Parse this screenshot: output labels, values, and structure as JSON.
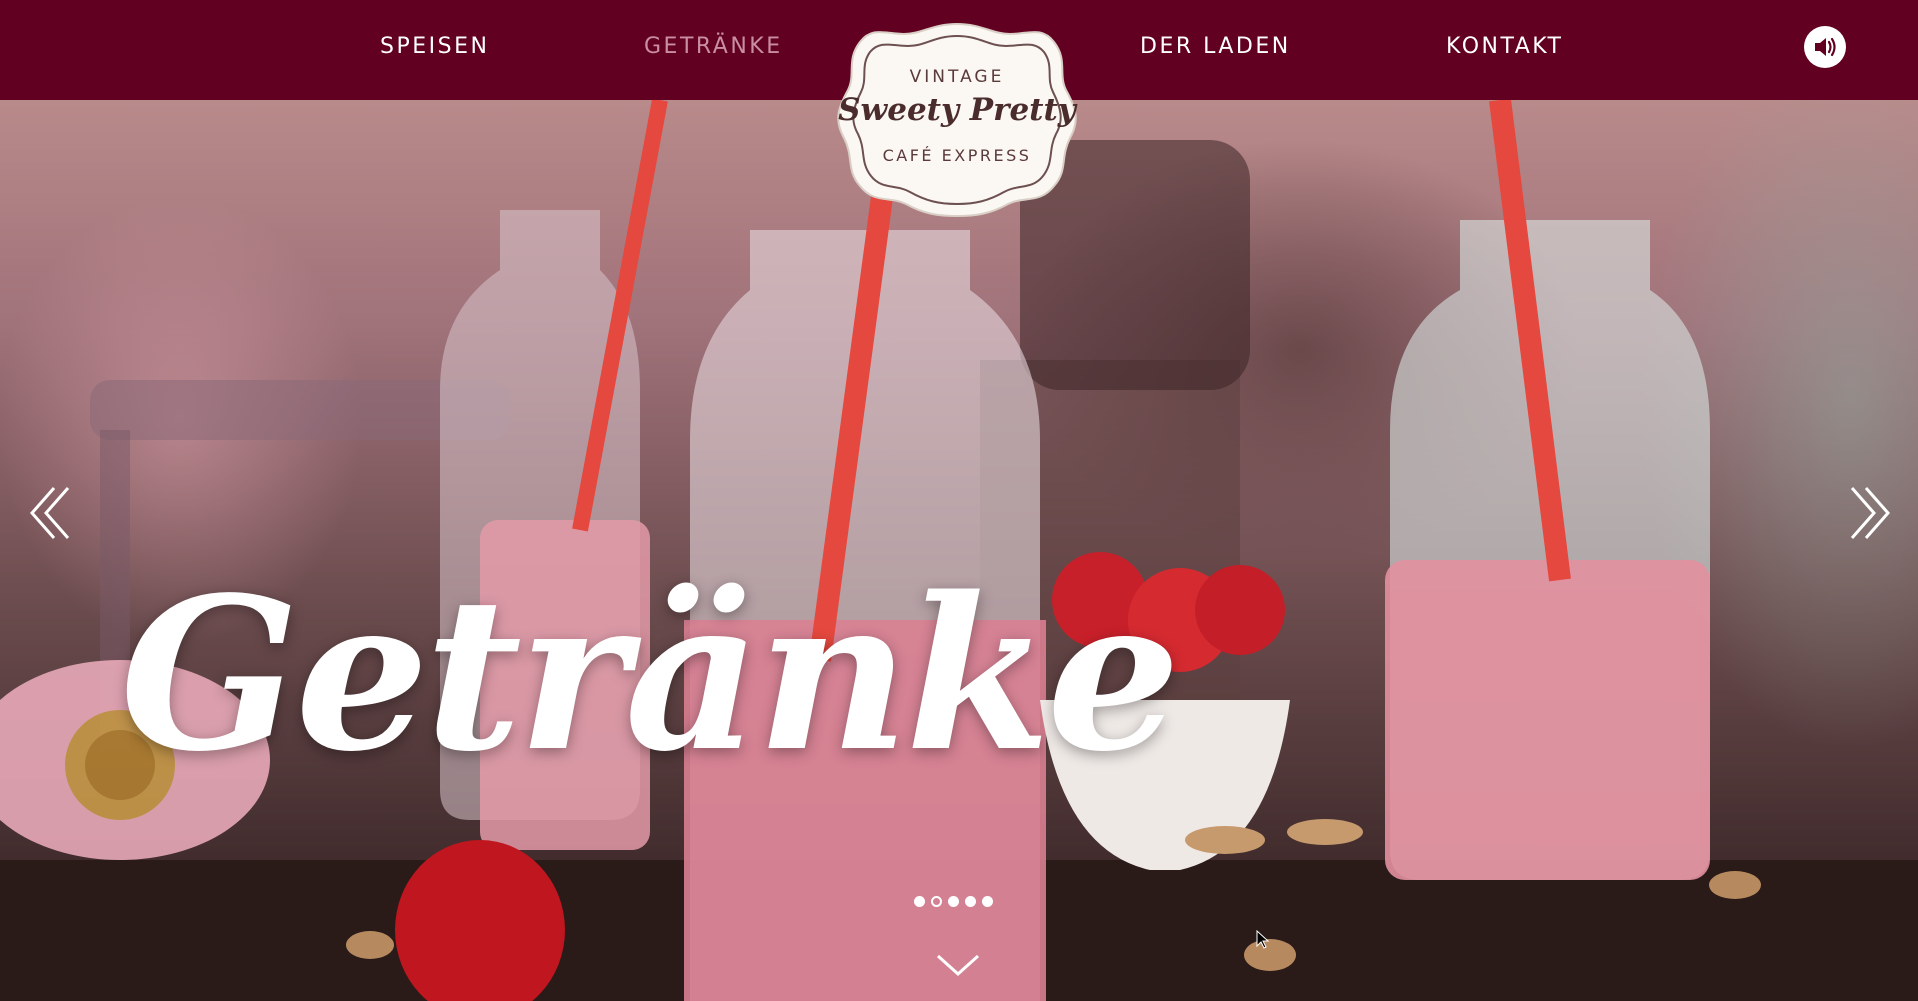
{
  "nav": {
    "items": [
      {
        "label": "SPEISEN",
        "active": false
      },
      {
        "label": "GETRÄNKE",
        "active": true
      },
      {
        "label": "DER LADEN",
        "active": false
      },
      {
        "label": "KONTAKT",
        "active": false
      }
    ],
    "sound_icon": "speaker-icon"
  },
  "logo": {
    "line1": "VINTAGE",
    "line2": "Sweety Pretty",
    "line3": "CAFÉ EXPRESS"
  },
  "hero": {
    "title": "Getränke",
    "prev_icon": "double-chevron-left-icon",
    "next_icon": "double-chevron-right-icon",
    "scroll_icon": "chevron-down-icon",
    "slides_total": 5,
    "active_slide": 2
  },
  "colors": {
    "nav_bg": "#620022",
    "nav_text": "#ffffff",
    "nav_active": "#c98ea2",
    "logo_text": "#4a2c2c"
  }
}
